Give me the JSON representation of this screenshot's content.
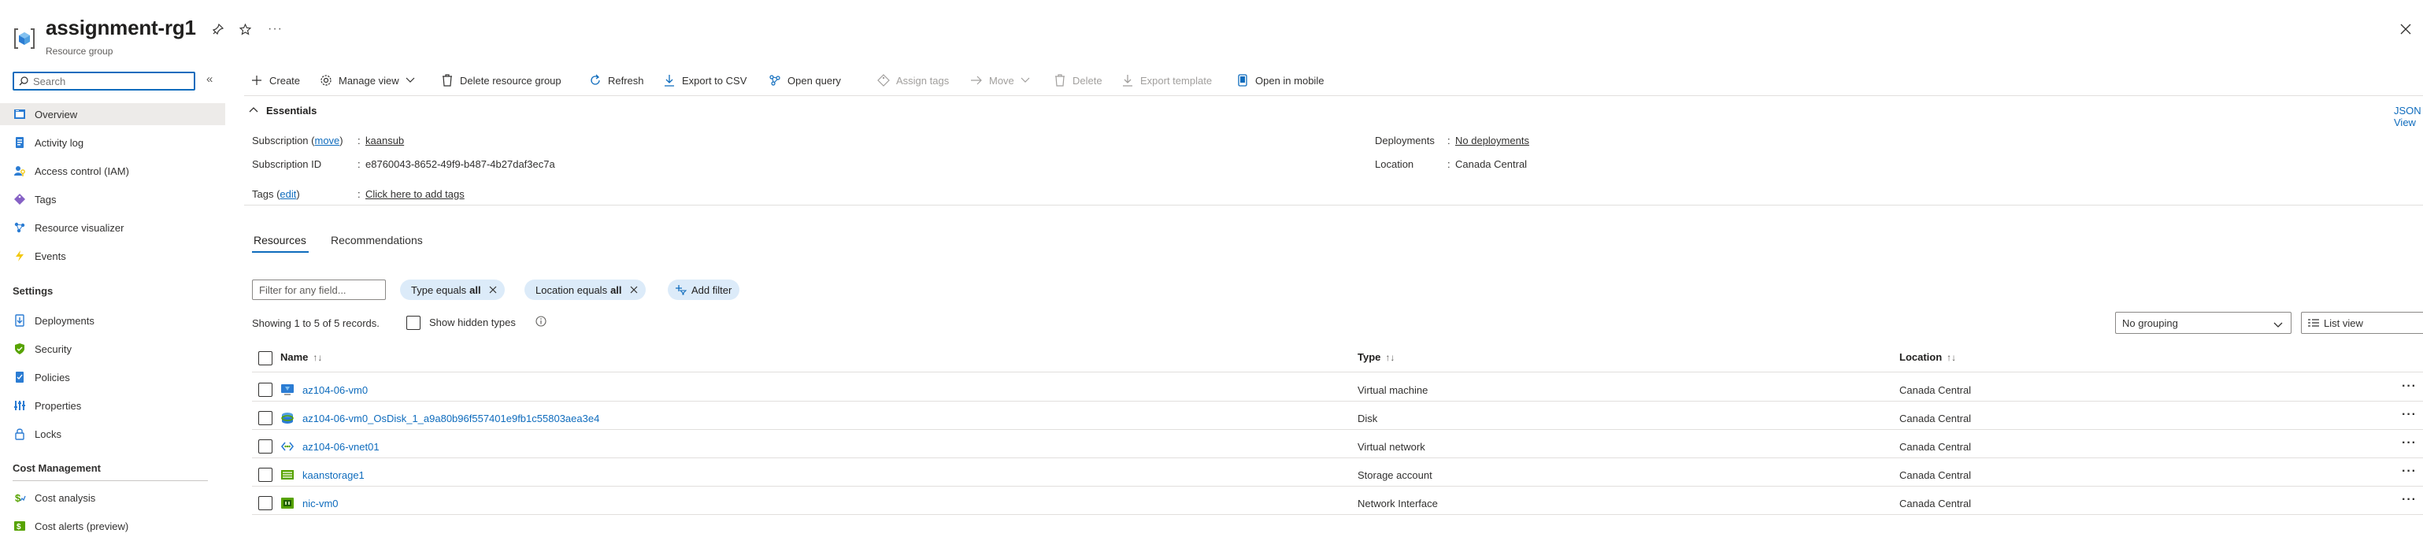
{
  "header": {
    "title": "assignment-rg1",
    "subtitle": "Resource group",
    "more": "···"
  },
  "nav": {
    "search_placeholder": "Search",
    "items": [
      {
        "label": "Overview",
        "icon": "overview-icon",
        "active": true
      },
      {
        "label": "Activity log",
        "icon": "activity-log-icon"
      },
      {
        "label": "Access control (IAM)",
        "icon": "iam-icon"
      },
      {
        "label": "Tags",
        "icon": "tag-icon"
      },
      {
        "label": "Resource visualizer",
        "icon": "visualizer-icon"
      },
      {
        "label": "Events",
        "icon": "events-icon"
      }
    ],
    "settings_title": "Settings",
    "settings_items": [
      {
        "label": "Deployments",
        "icon": "deployments-icon"
      },
      {
        "label": "Security",
        "icon": "security-icon"
      },
      {
        "label": "Policies",
        "icon": "policies-icon"
      },
      {
        "label": "Properties",
        "icon": "properties-icon"
      },
      {
        "label": "Locks",
        "icon": "lock-icon"
      }
    ],
    "cost_title": "Cost Management",
    "cost_items": [
      {
        "label": "Cost analysis",
        "icon": "cost-analysis-icon"
      },
      {
        "label": "Cost alerts (preview)",
        "icon": "cost-alerts-icon"
      }
    ]
  },
  "toolbar": {
    "create": "Create",
    "manage_view": "Manage view",
    "delete_rg": "Delete resource group",
    "refresh": "Refresh",
    "export_csv": "Export to CSV",
    "open_query": "Open query",
    "assign_tags": "Assign tags",
    "move": "Move",
    "delete": "Delete",
    "export_template": "Export template",
    "open_mobile": "Open in mobile"
  },
  "essentials": {
    "title": "Essentials",
    "json_view": "JSON View",
    "subscription_label": "Subscription",
    "subscription_move": "move",
    "subscription_value": "kaansub",
    "subscription_id_label": "Subscription ID",
    "subscription_id_value": "e8760043-8652-49f9-b487-4b27daf3ec7a",
    "tags_label": "Tags",
    "tags_edit": "edit",
    "tags_value": "Click here to add tags",
    "deployments_label": "Deployments",
    "deployments_value": "No deployments",
    "location_label": "Location",
    "location_value": "Canada Central",
    "colon": ":"
  },
  "tabs": [
    "Resources",
    "Recommendations"
  ],
  "filters": {
    "placeholder": "Filter for any field...",
    "type_label": "Type equals",
    "type_value": "all",
    "location_label": "Location equals",
    "location_value": "all",
    "add_filter": "Add filter"
  },
  "records": "Showing 1 to 5 of 5 records.",
  "show_hidden": "Show hidden types",
  "grouping": "No grouping",
  "view_mode": "List view",
  "columns": {
    "name": "Name",
    "type": "Type",
    "location": "Location"
  },
  "rows": [
    {
      "name": "az104-06-vm0",
      "type": "Virtual machine",
      "location": "Canada Central",
      "icon": "vm-icon"
    },
    {
      "name": "az104-06-vm0_OsDisk_1_a9a80b96f557401e9fb1c55803aea3e4",
      "type": "Disk",
      "location": "Canada Central",
      "icon": "disk-icon"
    },
    {
      "name": "az104-06-vnet01",
      "type": "Virtual network",
      "location": "Canada Central",
      "icon": "vnet-icon"
    },
    {
      "name": "kaanstorage1",
      "type": "Storage account",
      "location": "Canada Central",
      "icon": "storage-icon"
    },
    {
      "name": "nic-vm0",
      "type": "Network Interface",
      "location": "Canada Central",
      "icon": "nic-icon"
    }
  ],
  "row_more": "···",
  "colors": {
    "accent": "#0f6cbd",
    "nav_active": "#edebe9",
    "pill": "#dcebf9"
  }
}
